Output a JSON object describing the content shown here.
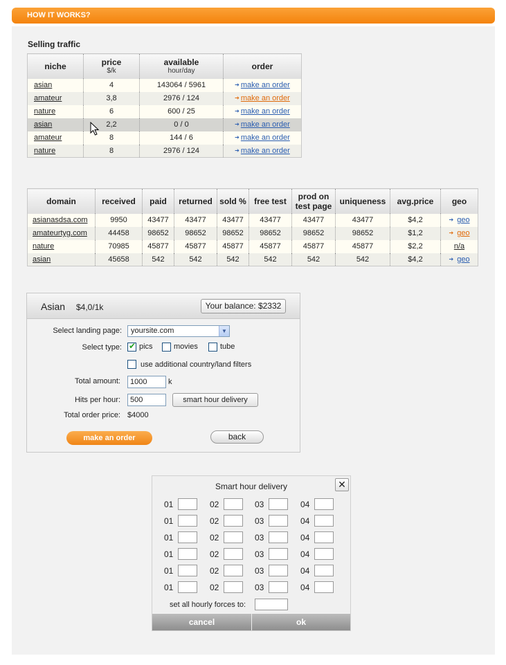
{
  "header": {
    "title": "HOW IT WORKS?"
  },
  "selling": {
    "title": "Selling traffic",
    "columns": {
      "niche": "niche",
      "price": "price",
      "price_unit": "$/k",
      "available": "available",
      "available_unit": "hour/day",
      "order": "order"
    },
    "rows": [
      {
        "niche": "asian",
        "price": "4",
        "available": "143064 / 5961",
        "order": "make an order",
        "accent": "blue"
      },
      {
        "niche": "amateur",
        "price": "3,8",
        "available": "2976 / 124",
        "order": "make an order",
        "accent": "orange"
      },
      {
        "niche": "nature",
        "price": "6",
        "available": "600 / 25",
        "order": "make an order",
        "accent": "blue"
      },
      {
        "niche": "asian",
        "price": "2,2",
        "available": "0 / 0",
        "order": "make an order",
        "accent": "blue"
      },
      {
        "niche": "amateur",
        "price": "8",
        "available": "144 / 6",
        "order": "make an order",
        "accent": "blue"
      },
      {
        "niche": "nature",
        "price": "8",
        "available": "2976 / 124",
        "order": "make an order",
        "accent": "blue"
      }
    ]
  },
  "domains": {
    "columns": {
      "domain": "domain",
      "received": "received",
      "paid": "paid",
      "returned": "returned",
      "sold": "sold %",
      "free_test": "free test",
      "prod_line1": "prod on",
      "prod_line2": "test page",
      "uniqueness": "uniqueness",
      "avg_price": "avg.price",
      "geo": "geo"
    },
    "rows": [
      {
        "domain": "asianasdsa.com",
        "received": "9950",
        "paid": "43477",
        "returned": "43477",
        "sold": "43477",
        "free_test": "43477",
        "prod": "43477",
        "uniqueness": "43477",
        "avg_price": "$4,2",
        "geo": "geo",
        "accent": "blue"
      },
      {
        "domain": "amateurtyg.com",
        "received": "44458",
        "paid": "98652",
        "returned": "98652",
        "sold": "98652",
        "free_test": "98652",
        "prod": "98652",
        "uniqueness": "98652",
        "avg_price": "$1,2",
        "geo": "geo",
        "accent": "orange"
      },
      {
        "domain": "nature",
        "received": "70985",
        "paid": "45877",
        "returned": "45877",
        "sold": "45877",
        "free_test": "45877",
        "prod": "45877",
        "uniqueness": "45877",
        "avg_price": "$2,2",
        "geo": "n/a",
        "accent": "none"
      },
      {
        "domain": "asian",
        "received": "45658",
        "paid": "542",
        "returned": "542",
        "sold": "542",
        "free_test": "542",
        "prod": "542",
        "uniqueness": "542",
        "avg_price": "$4,2",
        "geo": "geo",
        "accent": "blue"
      }
    ]
  },
  "order_form": {
    "niche": "Asian",
    "rate": "$4,0/1k",
    "balance": "Your balance: $2332",
    "landing_label": "Select landing page:",
    "landing_value": "yoursite.com",
    "type_label": "Select type:",
    "types": [
      {
        "label": "pics",
        "checked": true
      },
      {
        "label": "movies",
        "checked": false
      },
      {
        "label": "tube",
        "checked": false
      }
    ],
    "filters_label": "use additional country/land filters",
    "amount_label": "Total amount:",
    "amount_value": "1000",
    "amount_unit": "k",
    "hits_label": "Hits per hour:",
    "hits_value": "500",
    "smart_button": "smart hour delivery",
    "price_label": "Total order price:",
    "price_value": "$4000",
    "order_button": "make an order",
    "back_button": "back"
  },
  "smart_dialog": {
    "title": "Smart hour delivery",
    "close": "✕",
    "hour_labels": [
      "01",
      "02",
      "03",
      "04"
    ],
    "set_all_label": "set all hourly forces to:",
    "cancel": "cancel",
    "ok": "ok"
  },
  "colors": {
    "accent_orange": "#f4830d",
    "link_blue": "#2a5db0",
    "panel_bg": "#f2f2f2"
  }
}
